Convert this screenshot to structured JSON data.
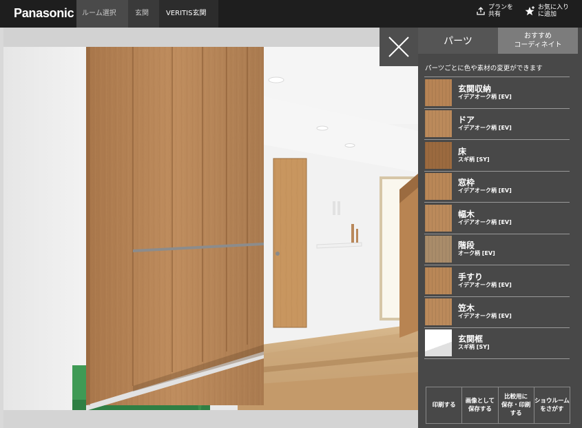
{
  "header": {
    "logo": "Panasonic",
    "breadcrumbs": [
      "ルーム選択",
      "玄関",
      "VERITIS玄関"
    ],
    "share_line1": "プランを",
    "share_line2": "共有",
    "fav_line1": "お気に入り",
    "fav_line2": "に追加"
  },
  "panel": {
    "tab_parts": "パーツ",
    "tab_coord_line1": "おすすめ",
    "tab_coord_line2": "コーディネイト",
    "description": "パーツごとに色や素材の変更ができます",
    "items": [
      {
        "name": "玄関収納",
        "material": "イデアオーク柄 [EV]",
        "swatch": "#b78455"
      },
      {
        "name": "ドア",
        "material": "イデアオーク柄 [EV]",
        "swatch": "#bb8a5b"
      },
      {
        "name": "床",
        "material": "スギ柄 [SY]",
        "swatch": "#9b6a3f"
      },
      {
        "name": "窓枠",
        "material": "イデアオーク柄 [EV]",
        "swatch": "#b98757"
      },
      {
        "name": "幅木",
        "material": "イデアオーク柄 [EV]",
        "swatch": "#bb8a5b"
      },
      {
        "name": "階段",
        "material": "オーク柄 [EV]",
        "swatch": "#a98c6a"
      },
      {
        "name": "手すり",
        "material": "イデアオーク柄 [EV]",
        "swatch": "#b98757"
      },
      {
        "name": "笠木",
        "material": "イデアオーク柄 [EV]",
        "swatch": "#bb8a5b"
      },
      {
        "name": "玄関框",
        "material": "スギ柄 [SY]",
        "swatch": "#ffffff"
      }
    ],
    "actions": [
      {
        "line1": "印刷する",
        "line2": "",
        "line3": ""
      },
      {
        "line1": "画像として",
        "line2": "保存する",
        "line3": ""
      },
      {
        "line1": "比較用に",
        "line2": "保存・印刷",
        "line3": "する"
      },
      {
        "line1": "ショウルーム",
        "line2": "をさがす",
        "line3": ""
      }
    ]
  },
  "colors": {
    "header_bg": "#1e1e1e",
    "panel_bg": "#424242",
    "wood": "#b78455",
    "floor": "#c9a57b",
    "wall": "#efefef",
    "grass": "#3f9a55"
  }
}
